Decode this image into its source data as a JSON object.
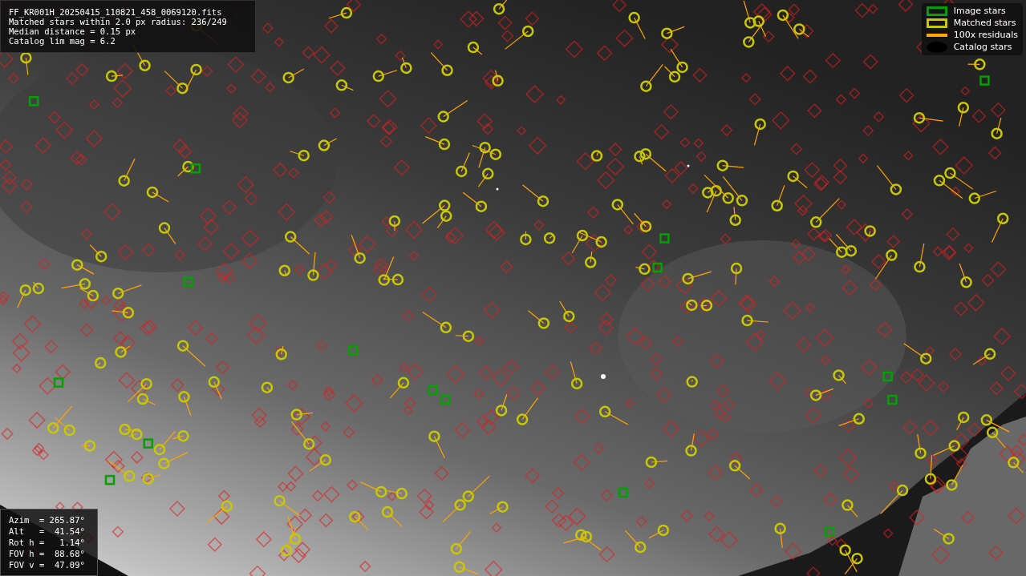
{
  "info": {
    "lines": [
      "FF_KR001H_20250415_110821_458_0069120.fits",
      "Matched stars within 2.0 px radius: 236/249",
      "Median distance = 0.15 px",
      "Catalog lim mag = 6.2"
    ]
  },
  "legend": {
    "items": [
      {
        "kind": "box",
        "color": "#00a000",
        "label": "Image stars"
      },
      {
        "kind": "box",
        "color": "#c8c800",
        "label": "Matched stars"
      },
      {
        "kind": "line",
        "color": "#ffa500",
        "label": "100x residuals"
      },
      {
        "kind": "diamond",
        "color": "#000000",
        "label": "Catalog stars"
      }
    ]
  },
  "pointing": {
    "lines": [
      "Azim  = 265.87°",
      "Alt   =  41.54°",
      "Rot h =   1.14°",
      "FOV h =  88.68°",
      "FOV v =  47.09°"
    ]
  }
}
